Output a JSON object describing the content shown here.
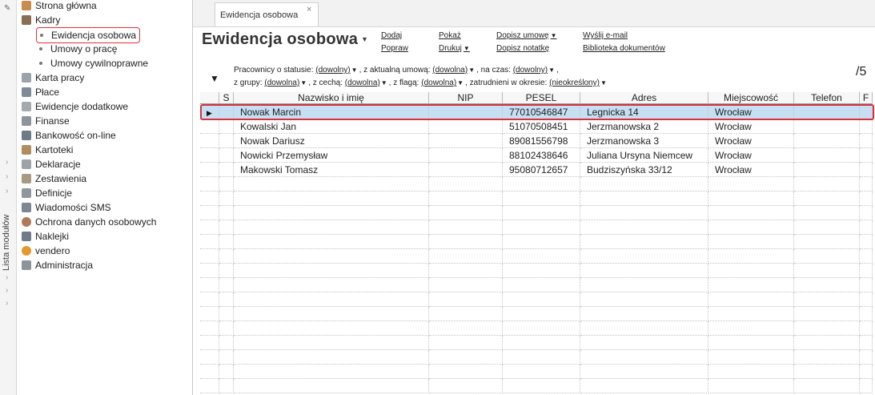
{
  "module_strip": {
    "label": "Lista modułów"
  },
  "sidebar": {
    "items": [
      {
        "label": "Strona główna"
      },
      {
        "label": "Kadry"
      },
      {
        "label": "Ewidencja osobowa"
      },
      {
        "label": "Umowy o pracę"
      },
      {
        "label": "Umowy cywilnoprawne"
      },
      {
        "label": "Karta pracy"
      },
      {
        "label": "Płace"
      },
      {
        "label": "Ewidencje dodatkowe"
      },
      {
        "label": "Finanse"
      },
      {
        "label": "Bankowość on-line"
      },
      {
        "label": "Kartoteki"
      },
      {
        "label": "Deklaracje"
      },
      {
        "label": "Zestawienia"
      },
      {
        "label": "Definicje"
      },
      {
        "label": "Wiadomości SMS"
      },
      {
        "label": "Ochrona danych osobowych"
      },
      {
        "label": "Naklejki"
      },
      {
        "label": "vendero"
      },
      {
        "label": "Administracja"
      }
    ]
  },
  "tab": {
    "label": "Ewidencja osobowa",
    "close": "×"
  },
  "page": {
    "title": "Ewidencja osobowa",
    "count": "/5"
  },
  "actions": {
    "dodaj": "Dodaj",
    "popraw": "Popraw",
    "pokaz": "Pokaż",
    "drukuj": "Drukuj",
    "dopisz_umowe": "Dopisz umowę",
    "dopisz_notatke": "Dopisz notatkę",
    "wyslij": "Wyślij e-mail",
    "biblioteka": "Biblioteka dokumentów"
  },
  "filters": {
    "status_label": "Pracownicy o statusie:",
    "status_value": "(dowolny)",
    "umowa_label": ", z aktualną umową:",
    "umowa_value": "(dowolna)",
    "czas_label": ", na czas:",
    "czas_value": "(dowolny)",
    "czas_tail": ",",
    "grupa_label": "z grupy:",
    "grupa_value": "(dowolna)",
    "cecha_label": ", z cechą:",
    "cecha_value": "(dowolna)",
    "flaga_label": ", z flagą:",
    "flaga_value": "(dowolna)",
    "okres_label": ", zatrudnieni w okresie:",
    "okres_value": "(nieokreślony)"
  },
  "table": {
    "columns": [
      "S",
      "Nazwisko i imię",
      "NIP",
      "PESEL",
      "Adres",
      "Miejscowość",
      "Telefon",
      "F"
    ],
    "rows": [
      [
        "",
        "Nowak Marcin",
        "",
        "77010546847",
        "Legnicka 14",
        "Wrocław",
        "",
        ""
      ],
      [
        "",
        "Kowalski Jan",
        "",
        "51070508451",
        "Jerzmanowska 2",
        "Wrocław",
        "",
        ""
      ],
      [
        "",
        "Nowak Dariusz",
        "",
        "89081556798",
        "Jerzmanowska 3",
        "Wrocław",
        "",
        ""
      ],
      [
        "",
        "Nowicki Przemysław",
        "",
        "88102438646",
        "Juliana Ursyna Niemcew",
        "Wrocław",
        "",
        ""
      ],
      [
        "",
        "Makowski Tomasz",
        "",
        "95080712657",
        "Budziszyńska 33/12",
        "Wrocław",
        "",
        ""
      ]
    ],
    "selected_row": 0
  },
  "colors": {
    "selection": "#c7dff3",
    "highlight": "#d8323c",
    "title": "#333333"
  }
}
